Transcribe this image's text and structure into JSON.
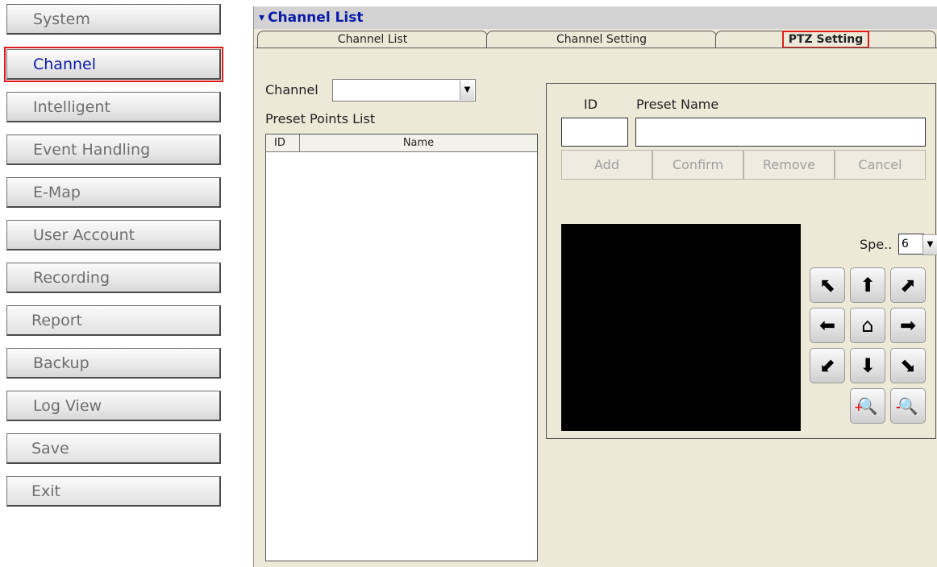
{
  "sidebar": {
    "items": [
      {
        "label": "System"
      },
      {
        "label": "Channel"
      },
      {
        "label": "Intelligent"
      },
      {
        "label": "Event Handling"
      },
      {
        "label": "E-Map"
      },
      {
        "label": "User Account"
      },
      {
        "label": "Recording"
      },
      {
        "label": "Report"
      },
      {
        "label": "Backup"
      },
      {
        "label": "Log View"
      },
      {
        "label": "Save"
      },
      {
        "label": "Exit"
      }
    ]
  },
  "panel": {
    "title": "Channel List",
    "tabs": [
      {
        "label": "Channel List"
      },
      {
        "label": "Channel Setting"
      },
      {
        "label": "PTZ Setting"
      }
    ]
  },
  "channel": {
    "label": "Channel",
    "selected": ""
  },
  "preset_list": {
    "title": "Preset Points List",
    "columns": [
      "ID",
      "Name"
    ],
    "rows": []
  },
  "preset_editor": {
    "id_label": "ID",
    "name_label": "Preset Name",
    "id_value": "",
    "name_value": "",
    "buttons": {
      "add": "Add",
      "confirm": "Confirm",
      "remove": "Remove",
      "cancel": "Cancel"
    }
  },
  "ptz": {
    "speed_label": "Spe..",
    "speed_value": "6",
    "controls": {
      "up_left": "⬉",
      "up": "⬆",
      "up_right": "⬈",
      "left": "⬅",
      "home": "⌂",
      "right": "➡",
      "down_left": "⬋",
      "down": "⬇",
      "down_right": "⬊",
      "zoom_in": "🔍",
      "zoom_out": "🔍"
    }
  }
}
